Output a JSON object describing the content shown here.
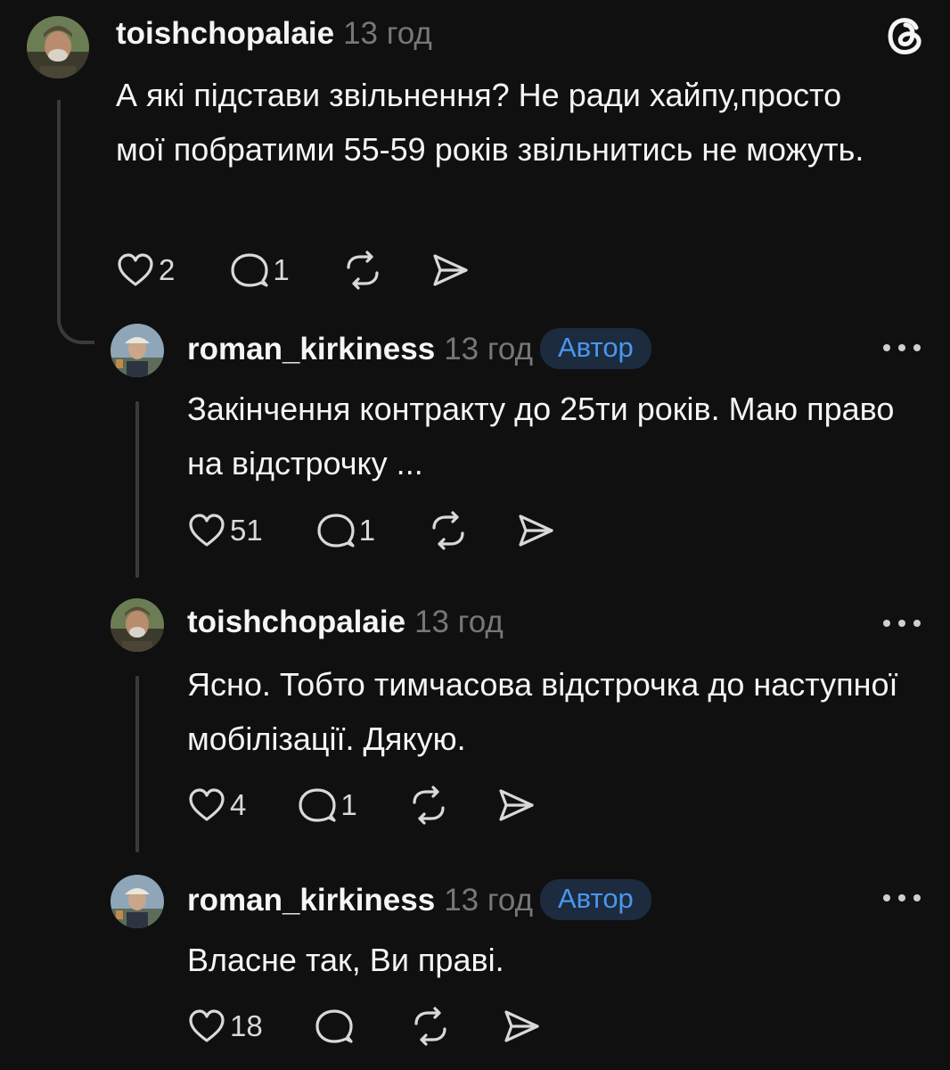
{
  "posts": [
    {
      "username": "toishchopalaie",
      "time": "13 год",
      "text": "А які підстави звільнення? Не ради хайпу,просто мої побратими 55-59 років звільнитись не можуть.",
      "likes": "2",
      "replies": "1"
    },
    {
      "username": "roman_kirkiness",
      "time": "13 год",
      "badge": "Автор",
      "text": "Закінчення контракту до 25ти років. Маю право на відстрочку ...",
      "likes": "51",
      "replies": "1"
    },
    {
      "username": "toishchopalaie",
      "time": "13 год",
      "text": "Ясно. Тобто тимчасова відстрочка до наступної мобілізації. Дякую.",
      "likes": "4",
      "replies": "1"
    },
    {
      "username": "roman_kirkiness",
      "time": "13 год",
      "badge": "Автор",
      "text": "Власне так, Ви праві.",
      "likes": "18",
      "replies": ""
    }
  ],
  "icons": {
    "like": "heart-icon",
    "reply": "comment-icon",
    "repost": "repost-icon",
    "share": "share-icon",
    "more": "more-icon",
    "app": "threads-logo-icon"
  },
  "colors": {
    "background": "#101010",
    "text": "#f3f5f7",
    "muted": "#777777",
    "badge_bg": "#1c2b3d",
    "badge_text": "#4a96ee"
  }
}
